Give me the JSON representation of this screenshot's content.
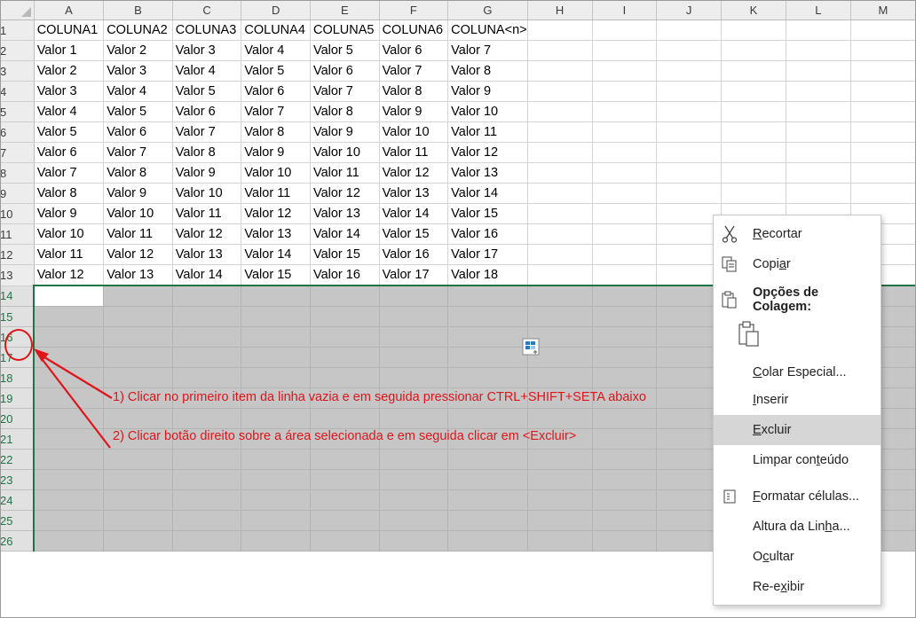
{
  "columns": [
    "A",
    "B",
    "C",
    "D",
    "E",
    "F",
    "G",
    "H",
    "I",
    "J",
    "K",
    "L",
    "M"
  ],
  "rows": [
    {
      "num": "1",
      "cells": [
        "COLUNA1",
        "COLUNA2",
        "COLUNA3",
        "COLUNA4",
        "COLUNA5",
        "COLUNA6",
        "COLUNA<n>",
        "",
        "",
        "",
        "",
        "",
        ""
      ]
    },
    {
      "num": "2",
      "cells": [
        "Valor 1",
        "Valor 2",
        "Valor 3",
        "Valor 4",
        "Valor 5",
        "Valor 6",
        "Valor 7",
        "",
        "",
        "",
        "",
        "",
        ""
      ]
    },
    {
      "num": "3",
      "cells": [
        "Valor 2",
        "Valor 3",
        "Valor 4",
        "Valor 5",
        "Valor 6",
        "Valor 7",
        "Valor 8",
        "",
        "",
        "",
        "",
        "",
        ""
      ]
    },
    {
      "num": "4",
      "cells": [
        "Valor 3",
        "Valor 4",
        "Valor 5",
        "Valor 6",
        "Valor 7",
        "Valor 8",
        "Valor 9",
        "",
        "",
        "",
        "",
        "",
        ""
      ]
    },
    {
      "num": "5",
      "cells": [
        "Valor 4",
        "Valor 5",
        "Valor 6",
        "Valor 7",
        "Valor 8",
        "Valor 9",
        "Valor 10",
        "",
        "",
        "",
        "",
        "",
        ""
      ]
    },
    {
      "num": "6",
      "cells": [
        "Valor 5",
        "Valor 6",
        "Valor 7",
        "Valor 8",
        "Valor 9",
        "Valor 10",
        "Valor 11",
        "",
        "",
        "",
        "",
        "",
        ""
      ]
    },
    {
      "num": "7",
      "cells": [
        "Valor 6",
        "Valor 7",
        "Valor 8",
        "Valor 9",
        "Valor 10",
        "Valor 11",
        "Valor 12",
        "",
        "",
        "",
        "",
        "",
        ""
      ]
    },
    {
      "num": "8",
      "cells": [
        "Valor 7",
        "Valor 8",
        "Valor 9",
        "Valor 10",
        "Valor 11",
        "Valor 12",
        "Valor 13",
        "",
        "",
        "",
        "",
        "",
        ""
      ]
    },
    {
      "num": "9",
      "cells": [
        "Valor 8",
        "Valor 9",
        "Valor 10",
        "Valor 11",
        "Valor 12",
        "Valor 13",
        "Valor 14",
        "",
        "",
        "",
        "",
        "",
        ""
      ]
    },
    {
      "num": "10",
      "cells": [
        "Valor 9",
        "Valor 10",
        "Valor 11",
        "Valor 12",
        "Valor 13",
        "Valor 14",
        "Valor 15",
        "",
        "",
        "",
        "",
        "",
        ""
      ]
    },
    {
      "num": "11",
      "cells": [
        "Valor 10",
        "Valor 11",
        "Valor 12",
        "Valor 13",
        "Valor 14",
        "Valor 15",
        "Valor 16",
        "",
        "",
        "",
        "",
        "",
        ""
      ]
    },
    {
      "num": "12",
      "cells": [
        "Valor 11",
        "Valor 12",
        "Valor 13",
        "Valor 14",
        "Valor 15",
        "Valor 16",
        "Valor 17",
        "",
        "",
        "",
        "",
        "",
        ""
      ]
    },
    {
      "num": "13",
      "cells": [
        "Valor 12",
        "Valor 13",
        "Valor 14",
        "Valor 15",
        "Valor 16",
        "Valor 17",
        "Valor 18",
        "",
        "",
        "",
        "",
        "",
        ""
      ]
    }
  ],
  "selected_rows": [
    "14",
    "15",
    "16",
    "17",
    "18",
    "19",
    "20",
    "21",
    "22",
    "23",
    "24",
    "25",
    "26"
  ],
  "annotations": {
    "step1": "1) Clicar no primeiro item da linha vazia e em seguida pressionar CTRL+SHIFT+SETA abaixo",
    "step2": "2) Clicar botão direito sobre a área selecionada e em seguida clicar em <Excluir>"
  },
  "context_menu": {
    "recortar": {
      "pre": "",
      "key": "R",
      "post": "ecortar",
      "icon": "scissors-icon"
    },
    "copiar": {
      "pre": "Copi",
      "key": "a",
      "post": "r",
      "icon": "copy-icon"
    },
    "opcoes": {
      "label": "Opções de Colagem:",
      "icon": "paste-options-icon"
    },
    "colar_especial": {
      "pre": "",
      "key": "C",
      "post": "olar Especial..."
    },
    "inserir": {
      "pre": "",
      "key": "I",
      "post": "nserir"
    },
    "excluir": {
      "pre": "",
      "key": "E",
      "post": "xcluir"
    },
    "limpar": {
      "pre": "Limpar con",
      "key": "t",
      "post": "eúdo"
    },
    "formatar": {
      "pre": "",
      "key": "F",
      "post": "ormatar células...",
      "icon": "format-cells-icon"
    },
    "altura": {
      "pre": "Altura da Lin",
      "key": "h",
      "post": "a..."
    },
    "ocultar": {
      "pre": "O",
      "key": "c",
      "post": "ultar"
    },
    "reexibir": {
      "pre": "Re-e",
      "key": "x",
      "post": "ibir"
    }
  },
  "colors": {
    "accent_green": "#217346",
    "annotation_red": "#e0151b",
    "selection_gray": "#c6c6c6"
  }
}
